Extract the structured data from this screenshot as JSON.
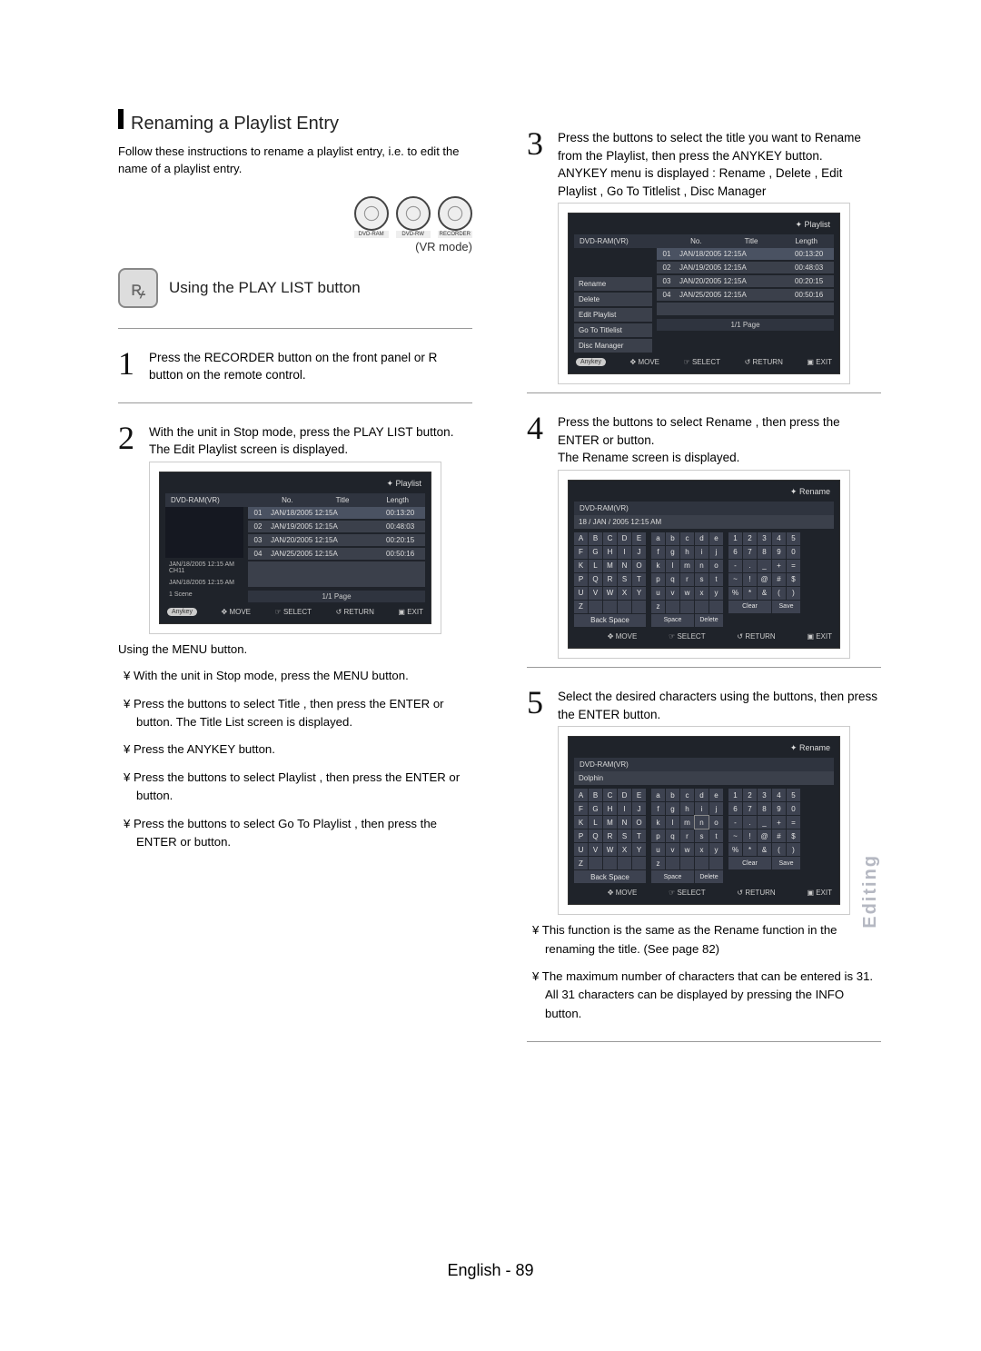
{
  "heading": "Renaming a Playlist Entry",
  "intro": "Follow these instructions to rename a playlist entry, i.e. to edit the name of a playlist entry.",
  "vr_mode": "(VR mode)",
  "disc_badges": [
    "DVD-RAM",
    "DVD-RW",
    "RECORDER"
  ],
  "using_button_title": "Using the PLAY LIST button",
  "step1": "Press the RECORDER button on the front panel or R button on the remote control.",
  "step2_line1": "With the unit in Stop mode, press the PLAY LIST button.",
  "step2_line2": "The Edit Playlist screen is displayed.",
  "using_menu": "Using the MENU button.",
  "menu_bullets": [
    "With the unit in Stop mode, press the MENU button.",
    "Press the        buttons to select Title , then press the ENTER or        button. The Title List screen is displayed.",
    "Press the ANYKEY button.",
    "Press the        buttons to select Playlist , then press the ENTER or        button.",
    "Press the        buttons to select Go To Playlist , then press the ENTER or        button."
  ],
  "step3_line1": "Press the        buttons to select the title you want to Rename from the Playlist, then press the ANYKEY button.",
  "step3_line2": "ANYKEY menu is displayed : Rename , Delete , Edit Playlist , Go To Titlelist , Disc Manager",
  "step4_line1": "Press the        buttons to select Rename , then press the ENTER or        button.",
  "step4_line2": "The Rename screen is displayed.",
  "step5": "Select the desired characters using the buttons, then press the ENTER button.",
  "step5_notes": [
    "This function is the same as the Rename function in the renaming the title. (See page 82)",
    "The maximum number of characters that can be entered is 31. All 31 characters can be displayed by pressing the INFO button."
  ],
  "osd": {
    "playlist_title": "Playlist",
    "drive_label": "DVD-RAM(VR)",
    "cols": {
      "no": "No.",
      "title": "Title",
      "length": "Length"
    },
    "page": "1/1 Page",
    "footer": {
      "anykey": "Anykey",
      "move": "MOVE",
      "select": "SELECT",
      "ret": "RETURN",
      "exit": "EXIT"
    },
    "rows": [
      {
        "no": "01",
        "title": "JAN/18/2005 12:15A",
        "len": "00:13:20"
      },
      {
        "no": "02",
        "title": "JAN/19/2005 12:15A",
        "len": "00:48:03"
      },
      {
        "no": "03",
        "title": "JAN/20/2005 12:15A",
        "len": "00:20:15"
      },
      {
        "no": "04",
        "title": "JAN/25/2005 12:15A",
        "len": "00:50:16"
      }
    ],
    "side_a": {
      "lines": [
        "JAN/18/2005 12:15 AM CH11",
        "JAN/18/2005 12:15 AM",
        "1 Scene"
      ]
    },
    "side_b": {
      "items": [
        "Rename",
        "Delete",
        "Edit Playlist",
        "Go To Titlelist",
        "Disc Manager"
      ]
    },
    "rename_title": "Rename",
    "rename_name1": "18 / JAN / 2005 12:15 AM",
    "rename_name2": "Dolphin",
    "upper": [
      "A",
      "B",
      "C",
      "D",
      "E",
      "F",
      "G",
      "H",
      "I",
      "J",
      "K",
      "L",
      "M",
      "N",
      "O",
      "P",
      "Q",
      "R",
      "S",
      "T",
      "U",
      "V",
      "W",
      "X",
      "Y",
      "Z"
    ],
    "lower": [
      "a",
      "b",
      "c",
      "d",
      "e",
      "f",
      "g",
      "h",
      "i",
      "j",
      "k",
      "l",
      "m",
      "n",
      "o",
      "p",
      "q",
      "r",
      "s",
      "t",
      "u",
      "v",
      "w",
      "x",
      "y",
      "z"
    ],
    "nums": [
      "1",
      "2",
      "3",
      "4",
      "5",
      "6",
      "7",
      "8",
      "9",
      "0",
      "-",
      ".",
      "_",
      "+",
      "=",
      "~",
      "!",
      "@",
      "#",
      "$",
      "%",
      "*",
      "&",
      "(",
      ")"
    ],
    "btns": {
      "back": "Back Space",
      "space": "Space",
      "delete": "Delete",
      "clear": "Clear",
      "save": "Save"
    }
  },
  "side_tab": "Editing",
  "page_number": "English - 89"
}
